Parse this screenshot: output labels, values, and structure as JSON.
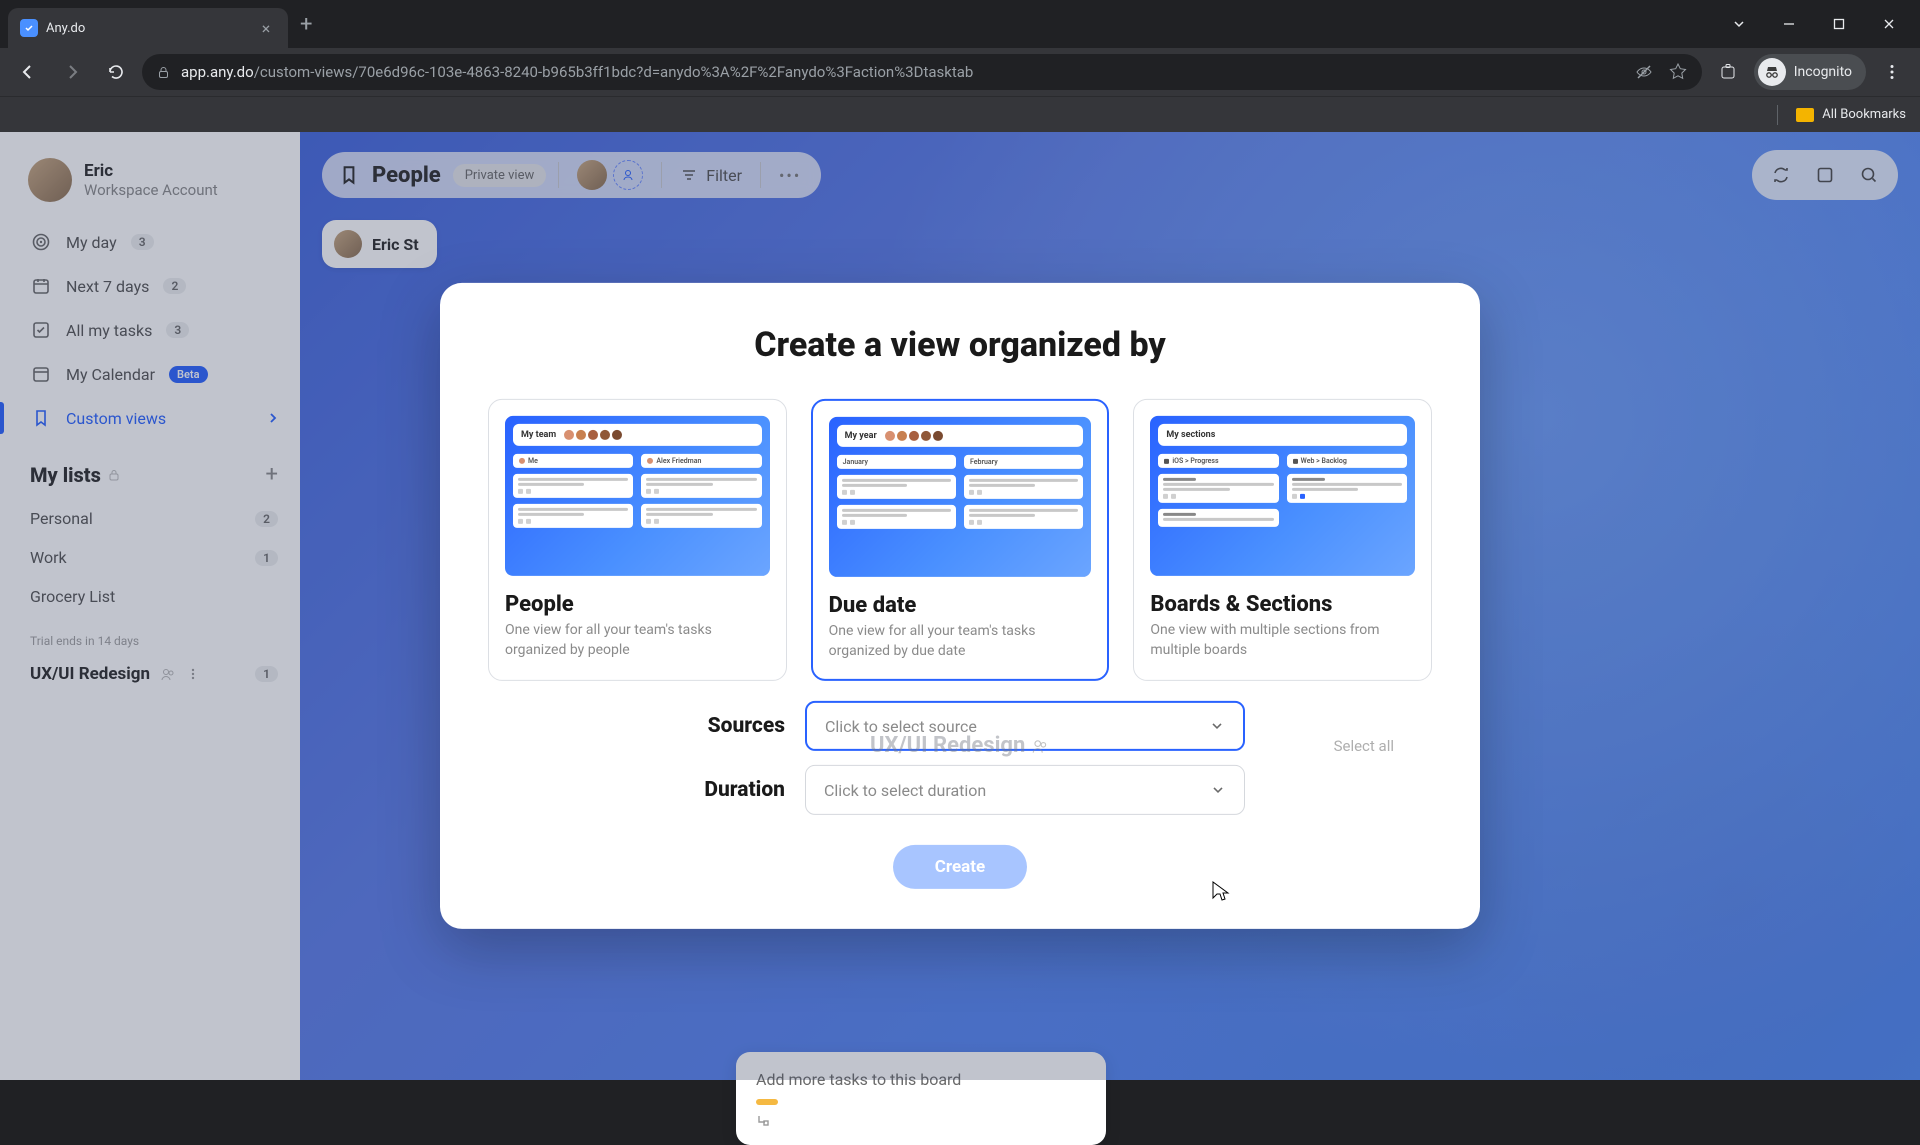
{
  "browser": {
    "tab_title": "Any.do",
    "url_host": "app.any.do",
    "url_path": "/custom-views/70e6d96c-103e-4863-8240-b965b3ff1bdc?d=anydo%3A%2F%2Fanydo%3Faction%3Dtasktab",
    "incognito_label": "Incognito",
    "all_bookmarks": "All Bookmarks"
  },
  "user": {
    "name": "Eric",
    "sub": "Workspace Account"
  },
  "nav": {
    "my_day": {
      "label": "My day",
      "count": "3"
    },
    "next7": {
      "label": "Next 7 days",
      "count": "2"
    },
    "all_tasks": {
      "label": "All my tasks",
      "count": "3"
    },
    "calendar": {
      "label": "My Calendar",
      "badge": "Beta"
    },
    "custom": {
      "label": "Custom views"
    }
  },
  "lists": {
    "header": "My lists",
    "personal": {
      "label": "Personal",
      "count": "2"
    },
    "work": {
      "label": "Work",
      "count": "1"
    },
    "grocery": {
      "label": "Grocery List"
    },
    "trial": "Trial ends in 14 days",
    "ux": {
      "label": "UX/UI Redesign",
      "count": "1"
    }
  },
  "view": {
    "title": "People",
    "private": "Private view",
    "filter": "Filter",
    "person_chip": "Eric St"
  },
  "modal": {
    "title": "Create a view organized by",
    "cards": {
      "people": {
        "title": "People",
        "desc": "One view for all your team's tasks organized by people",
        "preview_title": "My team",
        "col1": "Me",
        "col2": "Alex Friedman"
      },
      "due": {
        "title": "Due date",
        "desc": "One view for all your team's tasks organized by due date",
        "preview_title": "My year",
        "col1": "January",
        "col2": "February"
      },
      "boards": {
        "title": "Boards & Sections",
        "desc": "One view with multiple sections from multiple boards",
        "preview_title": "My sections",
        "col1": "iOS > Progress",
        "col2": "Web > Backlog"
      }
    },
    "ghost": "UX/UI Redesign",
    "select_all": "Select all",
    "sources_label": "Sources",
    "sources_placeholder": "Click to select source",
    "duration_label": "Duration",
    "duration_placeholder": "Click to select duration",
    "create": "Create"
  },
  "bottom_card": {
    "text": "Add more tasks to this board"
  }
}
